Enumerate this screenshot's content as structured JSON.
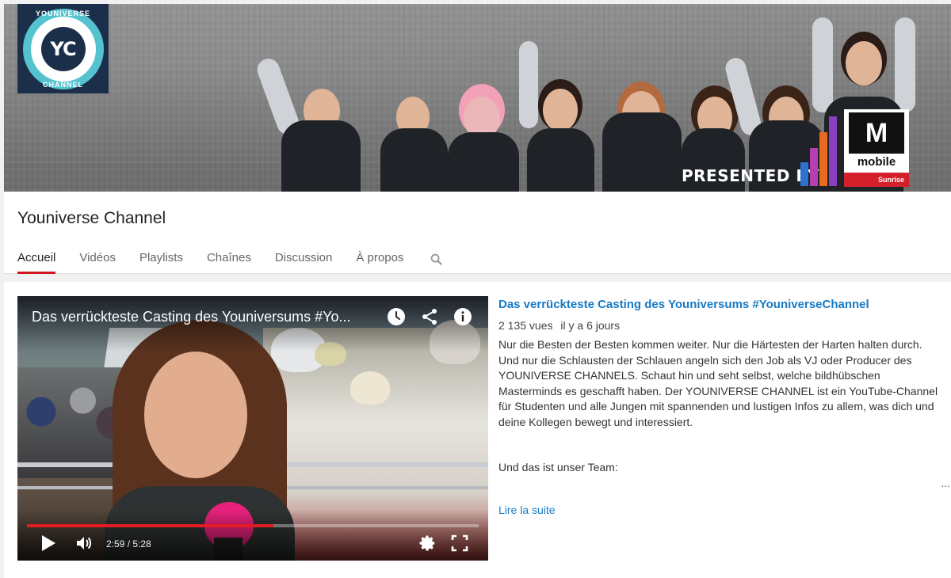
{
  "banner": {
    "logo": {
      "initials": "YC",
      "top_text": "YOUNIVERSE",
      "bottom_text": "CHANNEL"
    },
    "presented_by": "PRESENTED BY",
    "sponsor": {
      "brand": "M",
      "word": "mobile",
      "partner": "Sunrise"
    }
  },
  "channel": {
    "title": "Youniverse Channel",
    "tabs": [
      {
        "label": "Accueil",
        "active": true
      },
      {
        "label": "Vidéos"
      },
      {
        "label": "Playlists"
      },
      {
        "label": "Chaînes"
      },
      {
        "label": "Discussion"
      },
      {
        "label": "À propos"
      }
    ]
  },
  "featured": {
    "player": {
      "title": "Das verrückteste Casting des Youniversums #Yo...",
      "current_time": "2:59",
      "duration": "5:28",
      "progress": 0.546
    },
    "title": "Das verrückteste Casting des Youniversums #YouniverseChannel",
    "views": "2 135 vues",
    "age": "il y a 6 jours",
    "description": "Nur die Besten der Besten kommen weiter. Nur die Härtesten der Harten halten durch. Und nur die Schlausten der Schlauen angeln sich den Job als VJ oder Producer des YOUNIVERSE CHANNELS. Schaut hin und seht selbst, welche bildhübschen Masterminds es geschafft haben. Der YOUNIVERSE CHANNEL ist ein YouTube-Channel für Studenten und alle Jungen mit spannenden und lustigen Infos zu allem, was dich und deine Kollegen bewegt und interessiert.",
    "description_2": "Und das ist unser Team:",
    "ellipsis": "...",
    "read_more": "Lire la suite"
  }
}
